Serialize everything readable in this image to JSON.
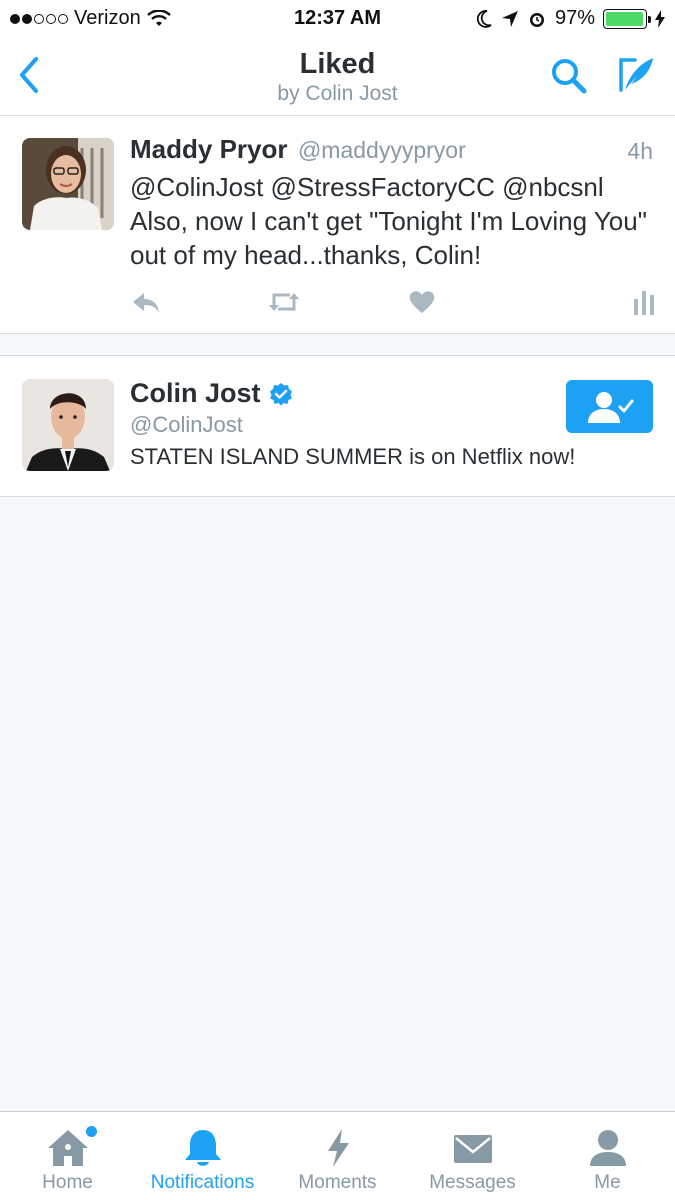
{
  "status_bar": {
    "carrier": "Verizon",
    "time": "12:37 AM",
    "battery_percent": "97%",
    "battery_level": 0.97,
    "signal_bars_filled": 2,
    "signal_bars_total": 5
  },
  "nav": {
    "title": "Liked",
    "subtitle": "by Colin Jost",
    "accent_color": "#1da1f2"
  },
  "tweet": {
    "name": "Maddy Pryor",
    "handle": "@maddyyypryor",
    "time": "4h",
    "text": "@ColinJost @StressFactoryCC @nbcsnl Also, now I can't get \"Tonight I'm Loving You\" out of my head...thanks, Colin!",
    "actions": [
      "reply-icon",
      "retweet-icon",
      "like-icon",
      "analytics-icon"
    ]
  },
  "user_card": {
    "name": "Colin Jost",
    "verified": true,
    "handle": "@ColinJost",
    "bio": "STATEN ISLAND SUMMER is on Netflix now!",
    "following": true
  },
  "tab_bar": {
    "tabs": [
      {
        "label": "Home",
        "icon": "home-icon",
        "active": false,
        "has_dot": true
      },
      {
        "label": "Notifications",
        "icon": "bell-icon",
        "active": true,
        "has_dot": false
      },
      {
        "label": "Moments",
        "icon": "lightning-icon",
        "active": false,
        "has_dot": false
      },
      {
        "label": "Messages",
        "icon": "envelope-icon",
        "active": false,
        "has_dot": false
      },
      {
        "label": "Me",
        "icon": "person-icon",
        "active": false,
        "has_dot": false
      }
    ]
  }
}
